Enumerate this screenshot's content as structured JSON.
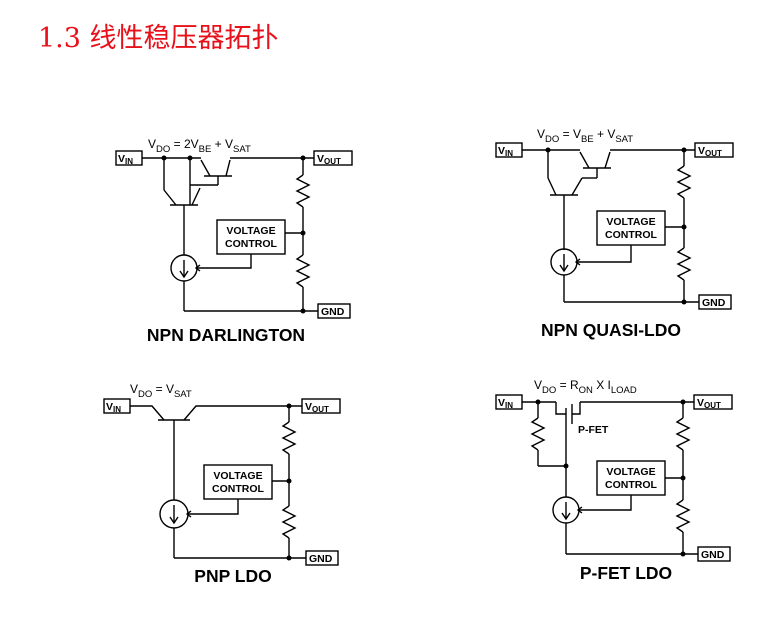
{
  "slide": {
    "title": "1.3 线性稳压器拓扑"
  },
  "pins": {
    "vin": "V",
    "vin_sub": "IN",
    "vout": "V",
    "vout_sub": "OUT",
    "gnd": "GND"
  },
  "voltage_control": {
    "line1": "VOLTAGE",
    "line2": "CONTROL"
  },
  "circuits": [
    {
      "name": "NPN DARLINGTON",
      "formula": {
        "t1": "V",
        "s1": "DO",
        "t2": " = 2V",
        "s2": "BE",
        "t3": " + V",
        "s3": "SAT"
      }
    },
    {
      "name": "NPN QUASI-LDO",
      "formula": {
        "t1": "V",
        "s1": "DO",
        "t2": " = V",
        "s2": "BE",
        "t3": " + V",
        "s3": "SAT"
      }
    },
    {
      "name": "PNP LDO",
      "formula": {
        "t1": "V",
        "s1": "DO",
        "t2": " = V",
        "s2": "SAT"
      }
    },
    {
      "name": "P-FET LDO",
      "formula": {
        "t1": "V",
        "s1": "DO",
        "t2": " = R",
        "s2": "ON",
        "t3": " X I",
        "s3": "LOAD"
      },
      "fet_label": "P-FET"
    }
  ]
}
